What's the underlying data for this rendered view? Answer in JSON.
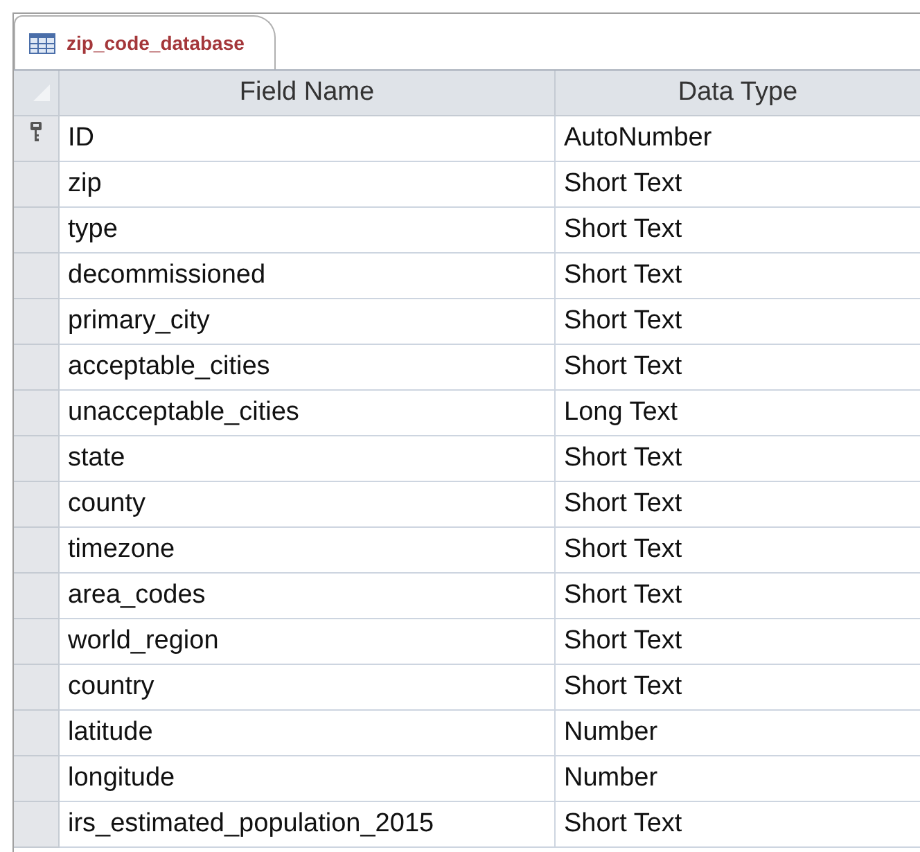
{
  "tabs": [
    {
      "label": "zip_code_database",
      "selected": true
    }
  ],
  "table": {
    "columns": [
      "Field Name",
      "Data Type"
    ],
    "rows": [
      {
        "field_name": "ID",
        "data_type": "AutoNumber",
        "primary_key": true
      },
      {
        "field_name": "zip",
        "data_type": "Short Text",
        "primary_key": false
      },
      {
        "field_name": "type",
        "data_type": "Short Text",
        "primary_key": false
      },
      {
        "field_name": "decommissioned",
        "data_type": "Short Text",
        "primary_key": false
      },
      {
        "field_name": "primary_city",
        "data_type": "Short Text",
        "primary_key": false
      },
      {
        "field_name": "acceptable_cities",
        "data_type": "Short Text",
        "primary_key": false
      },
      {
        "field_name": "unacceptable_cities",
        "data_type": "Long Text",
        "primary_key": false
      },
      {
        "field_name": "state",
        "data_type": "Short Text",
        "primary_key": false
      },
      {
        "field_name": "county",
        "data_type": "Short Text",
        "primary_key": false
      },
      {
        "field_name": "timezone",
        "data_type": "Short Text",
        "primary_key": false
      },
      {
        "field_name": "area_codes",
        "data_type": "Short Text",
        "primary_key": false
      },
      {
        "field_name": "world_region",
        "data_type": "Short Text",
        "primary_key": false
      },
      {
        "field_name": "country",
        "data_type": "Short Text",
        "primary_key": false
      },
      {
        "field_name": "latitude",
        "data_type": "Number",
        "primary_key": false
      },
      {
        "field_name": "longitude",
        "data_type": "Number",
        "primary_key": false
      },
      {
        "field_name": "irs_estimated_population_2015",
        "data_type": "Short Text",
        "primary_key": false
      }
    ]
  }
}
